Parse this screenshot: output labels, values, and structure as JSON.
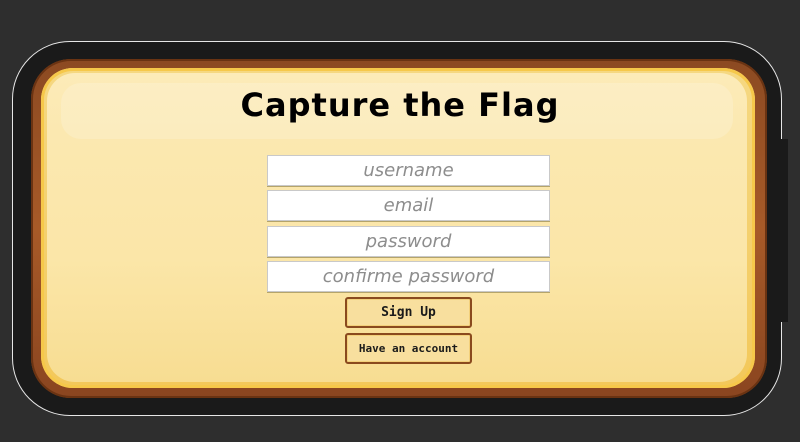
{
  "page": {
    "title": "Capture the Flag"
  },
  "form": {
    "username": {
      "value": "",
      "placeholder": "username"
    },
    "email": {
      "value": "",
      "placeholder": "email"
    },
    "password": {
      "value": "",
      "placeholder": "password"
    },
    "confirm_password": {
      "value": "",
      "placeholder": "confirme password"
    },
    "signup_label": "Sign Up",
    "account_label": "Have an account"
  },
  "colors": {
    "background": "#2e2e2e",
    "frame": "#1a1a1a",
    "board_border": "#a75a28",
    "board_fill": "#fbe6a8",
    "button_border": "#8a4a1e"
  }
}
